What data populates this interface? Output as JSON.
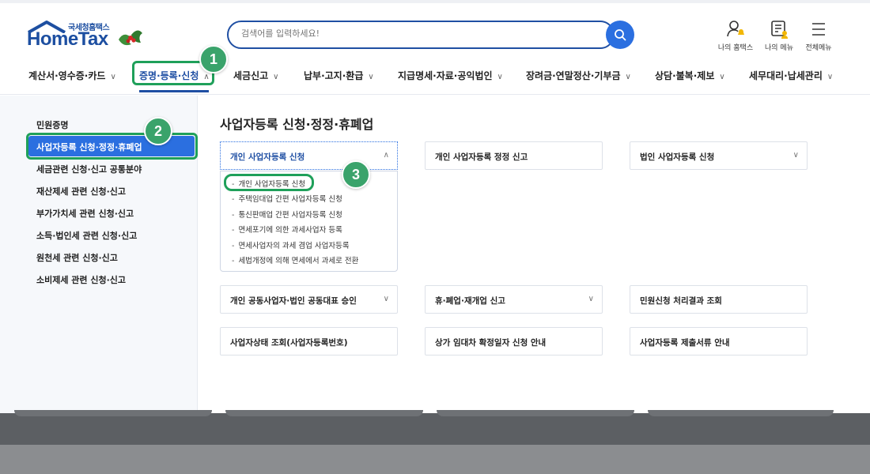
{
  "header": {
    "logo_sub": "국세청홈택스",
    "logo_main": "HomeTax",
    "search_placeholder": "검색어를 입력하세요!",
    "utils": [
      {
        "label": "나의 홈택스",
        "icon": "my-hometax-icon"
      },
      {
        "label": "나의 메뉴",
        "icon": "my-menu-icon"
      },
      {
        "label": "전체메뉴",
        "icon": "hamburger-menu-icon"
      }
    ],
    "gnb": [
      "계산서·영수증·카드",
      "증명·등록·신청",
      "세금신고",
      "납부·고지·환급",
      "지급명세·자료·공익법인",
      "장려금·연말정산·기부금",
      "상담·불복·제보",
      "세무대리·납세관리"
    ],
    "active_gnb": "증명·등록·신청"
  },
  "annotations": {
    "badge1": "1",
    "badge2": "2",
    "badge3": "3",
    "highlight_color": "#1fa05a"
  },
  "sidebar": {
    "items": [
      "민원증명",
      "사업자등록 신청·정정·휴폐업",
      "세금관련 신청·신고 공통분야",
      "재산제세 관련 신청·신고",
      "부가가치세 관련 신청·신고",
      "소득·법인세 관련 신청·신고",
      "원천세 관련 신청·신고",
      "소비제세 관련 신청·신고"
    ],
    "active": "사업자등록 신청·정정·휴폐업"
  },
  "main": {
    "title": "사업자등록 신청·정정·휴폐업",
    "cards": [
      {
        "label": "개인 사업자등록 신청",
        "chevron": "up",
        "open": true
      },
      {
        "label": "개인 사업자등록 정정 신고",
        "chevron": ""
      },
      {
        "label": "법인 사업자등록 신청",
        "chevron": "down"
      },
      {
        "label": "개인 공동사업자·법인 공동대표 승인",
        "chevron": "down"
      },
      {
        "label": "휴·폐업·재개업 신고",
        "chevron": "down"
      },
      {
        "label": "민원신청 처리결과 조회",
        "chevron": ""
      },
      {
        "label": "사업자상태 조회(사업자등록번호)",
        "chevron": ""
      },
      {
        "label": "상가 임대차 확정일자 신청 안내",
        "chevron": ""
      },
      {
        "label": "사업자등록 제출서류 안내",
        "chevron": ""
      }
    ],
    "dropdown": [
      "개인 사업자등록 신청",
      "주택임대업 간편 사업자등록 신청",
      "통신판매업 간편 사업자등록 신청",
      "면세포기에 의한 과세사업자 등록",
      "면세사업자의 과세 겸업 사업자등록",
      "세법개정에 의해 면세에서 과세로 전환"
    ]
  },
  "colors": {
    "brand": "#1f4fa3",
    "accent": "#2b6fe0"
  }
}
